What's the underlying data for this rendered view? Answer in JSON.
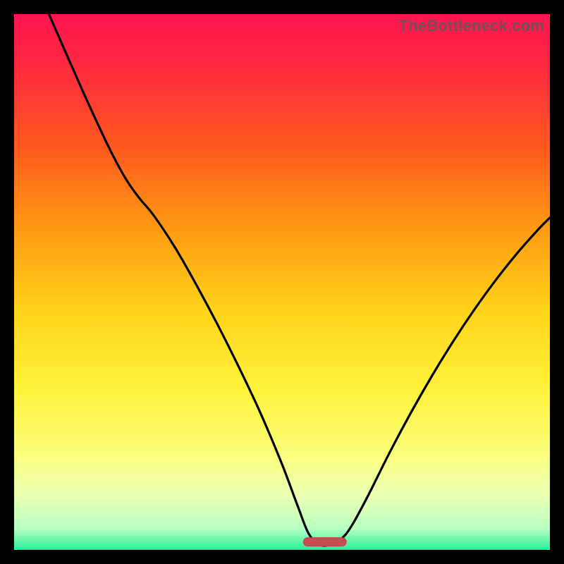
{
  "watermark": "TheBottleneck.com",
  "colors": {
    "frame_bg": "#000000",
    "gradient_stops": [
      {
        "offset": 0.0,
        "color": "#ff1450"
      },
      {
        "offset": 0.1,
        "color": "#ff2a3f"
      },
      {
        "offset": 0.25,
        "color": "#ff5a1e"
      },
      {
        "offset": 0.4,
        "color": "#ff9a12"
      },
      {
        "offset": 0.55,
        "color": "#ffd21a"
      },
      {
        "offset": 0.7,
        "color": "#fff23a"
      },
      {
        "offset": 0.82,
        "color": "#fbff7a"
      },
      {
        "offset": 0.9,
        "color": "#e9ffb4"
      },
      {
        "offset": 0.96,
        "color": "#b8ffc0"
      },
      {
        "offset": 1.0,
        "color": "#25f09a"
      }
    ],
    "curve_stroke": "#000000",
    "marker_fill": "#cc4a52",
    "marker_stroke": "#b83f47"
  },
  "chart_data": {
    "type": "line",
    "title": "",
    "xlabel": "",
    "ylabel": "",
    "xlim": [
      0,
      100
    ],
    "ylim": [
      0,
      100
    ],
    "optimum_x": 57,
    "marker": {
      "x_start": 54,
      "x_end": 62,
      "y": 1.5
    },
    "series": [
      {
        "name": "bottleneck-curve",
        "points": [
          {
            "x": 6.5,
            "y": 100.0
          },
          {
            "x": 10.0,
            "y": 92.0
          },
          {
            "x": 14.0,
            "y": 83.0
          },
          {
            "x": 18.0,
            "y": 74.5
          },
          {
            "x": 21.0,
            "y": 69.0
          },
          {
            "x": 23.5,
            "y": 65.5
          },
          {
            "x": 26.0,
            "y": 62.5
          },
          {
            "x": 30.0,
            "y": 56.5
          },
          {
            "x": 34.0,
            "y": 49.5
          },
          {
            "x": 38.0,
            "y": 42.0
          },
          {
            "x": 42.0,
            "y": 34.0
          },
          {
            "x": 46.0,
            "y": 25.5
          },
          {
            "x": 50.0,
            "y": 16.0
          },
          {
            "x": 53.0,
            "y": 8.0
          },
          {
            "x": 55.0,
            "y": 3.0
          },
          {
            "x": 57.0,
            "y": 1.0
          },
          {
            "x": 59.0,
            "y": 1.0
          },
          {
            "x": 61.0,
            "y": 2.0
          },
          {
            "x": 63.0,
            "y": 4.5
          },
          {
            "x": 66.0,
            "y": 10.0
          },
          {
            "x": 70.0,
            "y": 18.0
          },
          {
            "x": 74.0,
            "y": 25.5
          },
          {
            "x": 78.0,
            "y": 32.5
          },
          {
            "x": 82.0,
            "y": 39.0
          },
          {
            "x": 86.0,
            "y": 45.0
          },
          {
            "x": 90.0,
            "y": 50.5
          },
          {
            "x": 94.0,
            "y": 55.5
          },
          {
            "x": 98.0,
            "y": 60.0
          },
          {
            "x": 100.0,
            "y": 62.0
          }
        ]
      }
    ]
  }
}
